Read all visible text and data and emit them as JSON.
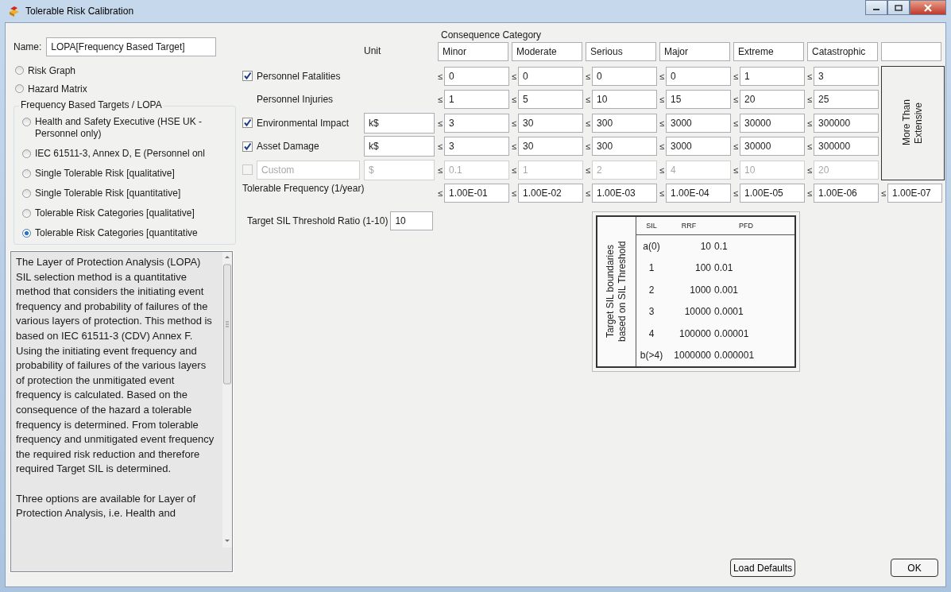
{
  "window": {
    "title": "Tolerable Risk Calibration"
  },
  "name_field": {
    "label": "Name:",
    "value": "LOPA[Frequency Based Target]"
  },
  "methods": [
    {
      "label": "Risk Graph",
      "selected": false
    },
    {
      "label": "Hazard Matrix",
      "selected": false
    }
  ],
  "lopa_group": {
    "title": "Frequency Based Targets / LOPA",
    "options": [
      {
        "label": "Health and Safety Executive (HSE UK - Personnel only)",
        "selected": false
      },
      {
        "label": "IEC 61511-3, Annex D, E (Personnel onl",
        "selected": false
      },
      {
        "label": "Single Tolerable Risk [qualitative]",
        "selected": false
      },
      {
        "label": "Single Tolerable Risk [quantitative]",
        "selected": false
      },
      {
        "label": "Tolerable Risk Categories [qualitative]",
        "selected": false
      },
      {
        "label": "Tolerable Risk Categories [quantitative",
        "selected": true
      }
    ]
  },
  "description": [
    "The Layer of Protection Analysis (LOPA) SIL selection method is a quantitative method that considers the initiating event frequency and probability of failures of the various layers of protection. This method is based on IEC 61511-3 (CDV) Annex F. Using the initiating event frequency and probability of failures of the various layers of protection the unmitigated event frequency is calculated. Based on the consequence of the hazard a tolerable frequency is determined. From tolerable frequency and unmitigated event frequency the required risk reduction and therefore required Target SIL is determined.",
    "Three options are available for Layer of Protection Analysis, i.e. Health and"
  ],
  "consequence": {
    "title": "Consequence Category",
    "unit_heading": "Unit",
    "categories": [
      "Minor",
      "Moderate",
      "Serious",
      "Major",
      "Extreme",
      "Catastrophic"
    ],
    "extra_category": "More Than Extensive",
    "rows": [
      {
        "kind": "check",
        "label": "Personnel Fatalities",
        "checked": true,
        "values": [
          {
            "op": "≤",
            "value": "0"
          },
          {
            "op": "≤",
            "value": "0"
          },
          {
            "op": "≤",
            "value": "0"
          },
          {
            "op": "≤",
            "value": "0"
          },
          {
            "op": "≤",
            "value": "1"
          },
          {
            "op": "≤",
            "value": "3"
          }
        ]
      },
      {
        "kind": "plain",
        "label": "Personnel Injuries",
        "values": [
          {
            "op": "≤",
            "value": "1"
          },
          {
            "op": "≤",
            "value": "5"
          },
          {
            "op": "≤",
            "value": "10"
          },
          {
            "op": "≤",
            "value": "15"
          },
          {
            "op": "≤",
            "value": "20"
          },
          {
            "op": "≤",
            "value": "25"
          }
        ]
      },
      {
        "kind": "check",
        "label": "Environmental Impact",
        "checked": true,
        "unit": "k$",
        "values": [
          {
            "op": "≤",
            "value": "3"
          },
          {
            "op": "≤",
            "value": "30"
          },
          {
            "op": "≤",
            "value": "300"
          },
          {
            "op": "≤",
            "value": "3000"
          },
          {
            "op": "≤",
            "value": "30000"
          },
          {
            "op": "≤",
            "value": "300000"
          }
        ]
      },
      {
        "kind": "check",
        "label": "Asset Damage",
        "checked": true,
        "unit": "k$",
        "values": [
          {
            "op": "≤",
            "value": "3"
          },
          {
            "op": "≤",
            "value": "30"
          },
          {
            "op": "≤",
            "value": "300"
          },
          {
            "op": "≤",
            "value": "3000"
          },
          {
            "op": "≤",
            "value": "30000"
          },
          {
            "op": "≤",
            "value": "300000"
          }
        ]
      },
      {
        "kind": "custom",
        "label": "Custom",
        "checked": false,
        "disabled": true,
        "unit": "$",
        "values": [
          {
            "op": "≤",
            "value": "0.1"
          },
          {
            "op": "≤",
            "value": "1"
          },
          {
            "op": "≤",
            "value": "2"
          },
          {
            "op": "≤",
            "value": "4"
          },
          {
            "op": "≤",
            "value": "10"
          },
          {
            "op": "≤",
            "value": "20"
          }
        ]
      }
    ],
    "frequency": {
      "label": "Tolerable Frequency (1/year)",
      "values": [
        {
          "op": "≤",
          "value": "1.00E-01"
        },
        {
          "op": "≤",
          "value": "1.00E-02"
        },
        {
          "op": "≤",
          "value": "1.00E-03"
        },
        {
          "op": "≤",
          "value": "1.00E-04"
        },
        {
          "op": "≤",
          "value": "1.00E-05"
        },
        {
          "op": "≤",
          "value": "1.00E-06"
        },
        {
          "op": "≤",
          "value": "1.00E-07"
        }
      ]
    }
  },
  "threshold": {
    "label": "Target SIL Threshold Ratio (1-10)",
    "value": "10"
  },
  "sil_table": {
    "title": "Target SIL boundaries based on SIL Threshold",
    "columns": [
      "SIL",
      "RRF",
      "PFD"
    ],
    "rows": [
      [
        "a(0)",
        "10",
        "0.1"
      ],
      [
        "1",
        "100",
        "0.01"
      ],
      [
        "2",
        "1000",
        "0.001"
      ],
      [
        "3",
        "10000",
        "0.0001"
      ],
      [
        "4",
        "100000",
        "0.00001"
      ],
      [
        "b(>4)",
        "1000000",
        "0.000001"
      ]
    ]
  },
  "buttons": [
    {
      "label": "Load Defaults"
    },
    {
      "label": "OK"
    }
  ]
}
